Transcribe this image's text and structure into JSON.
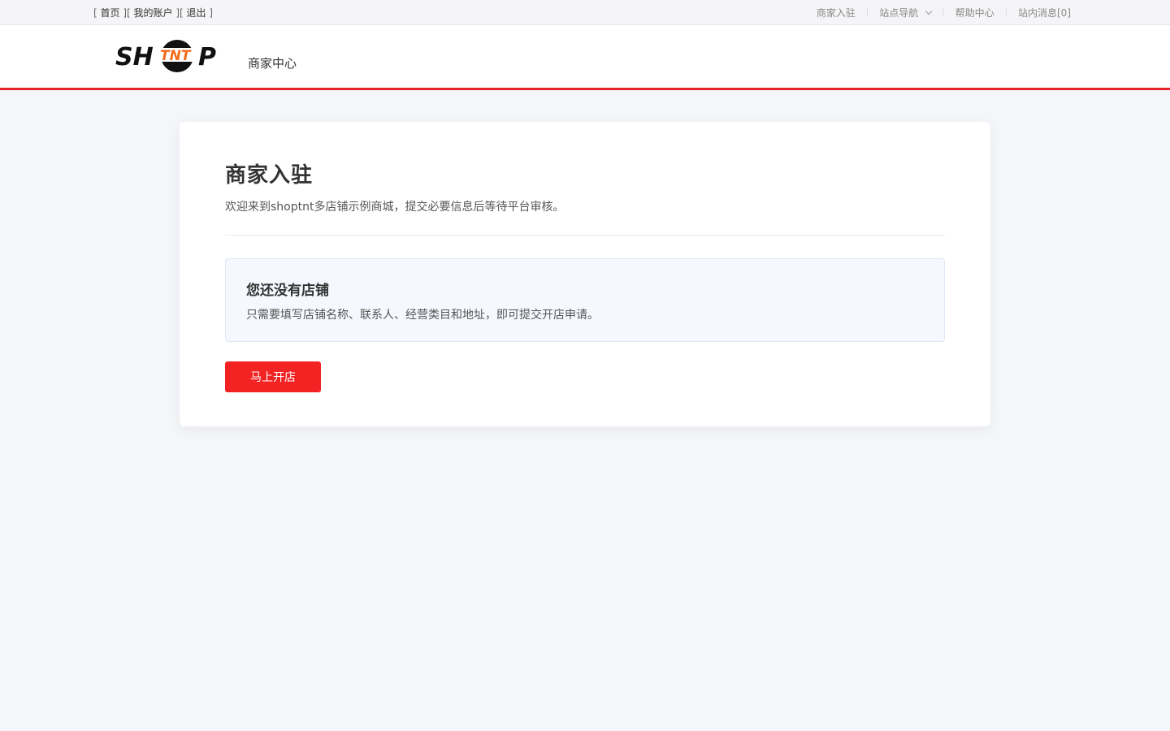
{
  "topbar": {
    "left_links": [
      {
        "label": "首页"
      },
      {
        "label": "我的账户"
      },
      {
        "label": "退出"
      }
    ],
    "right_links": [
      {
        "label": "商家入驻"
      },
      {
        "label": "站点导航"
      },
      {
        "label": "帮助中心"
      },
      {
        "label": "站内消息[0]"
      }
    ]
  },
  "header": {
    "logo_text": "SHTNTP",
    "title": "商家中心"
  },
  "main": {
    "title": "商家入驻",
    "subtitle": "欢迎来到shoptnt多店铺示例商城，提交必要信息后等待平台审核。",
    "notice": {
      "title": "您还没有店铺",
      "text": "只需要填写店铺名称、联系人、经营类目和地址，即可提交开店申请。"
    },
    "open_button_label": "马上开店"
  },
  "colors": {
    "accent": "#e5232a",
    "button": "#f32323",
    "logo_orange": "#f26b1d"
  }
}
